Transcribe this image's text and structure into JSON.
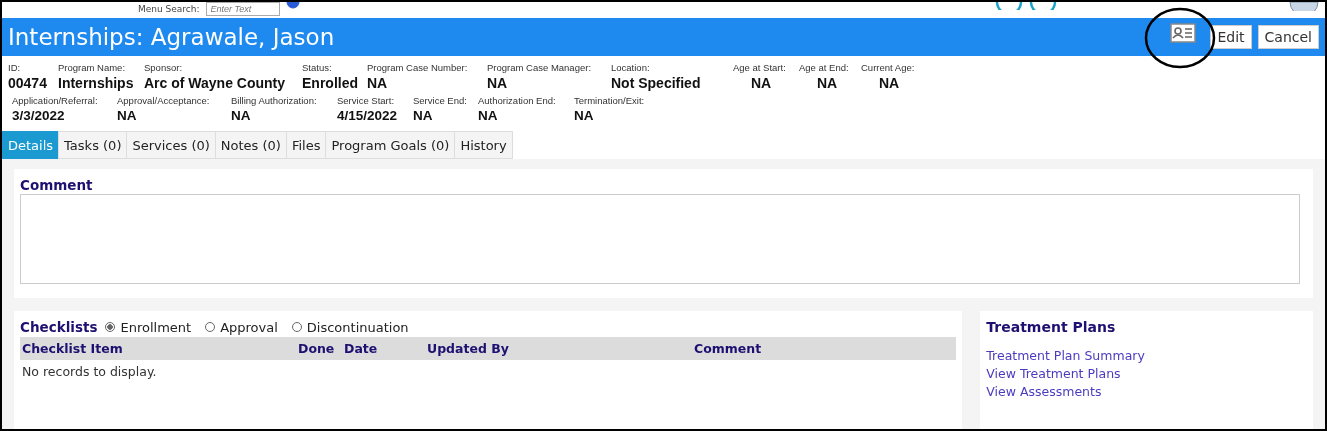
{
  "top_bar": {
    "search_label": "Menu Search:",
    "search_placeholder": "Enter Text"
  },
  "header": {
    "title": "Internships: Agrawale, Jason",
    "buttons": [
      {
        "label": "Edit"
      },
      {
        "label": "Cancel"
      }
    ]
  },
  "fields_row_1": [
    {
      "label": "ID:",
      "value": "00474"
    },
    {
      "label": "Program Name:",
      "value": "Internships"
    },
    {
      "label": "Sponsor:",
      "value": "Arc of Wayne County"
    },
    {
      "label": "Status:",
      "value": "Enrolled"
    },
    {
      "label": "Program Case Number:",
      "value": "NA"
    },
    {
      "label": "Program Case Manager:",
      "value": "NA"
    },
    {
      "label": "Location:",
      "value": "Not Specified"
    },
    {
      "label": "Age at Start:",
      "value": "NA"
    },
    {
      "label": "Age at End:",
      "value": "NA"
    },
    {
      "label": "Current Age:",
      "value": "NA"
    }
  ],
  "fields_row_2": [
    {
      "label": "Application/Referral:",
      "value": "3/3/2022"
    },
    {
      "label": "Approval/Acceptance:",
      "value": "NA"
    },
    {
      "label": "Billing Authorization:",
      "value": "NA"
    },
    {
      "label": "Service Start:",
      "value": "4/15/2022"
    },
    {
      "label": "Service End:",
      "value": "NA"
    },
    {
      "label": "Authorization End:",
      "value": "NA"
    },
    {
      "label": "Termination/Exit:",
      "value": "NA"
    }
  ],
  "tabs": [
    {
      "label": "Details",
      "selected": true
    },
    {
      "label": "Tasks (0)",
      "selected": false
    },
    {
      "label": "Services (0)",
      "selected": false
    },
    {
      "label": "Notes (0)",
      "selected": false
    },
    {
      "label": "Files",
      "selected": false
    },
    {
      "label": "Program Goals (0)",
      "selected": false
    },
    {
      "label": "History",
      "selected": false
    }
  ],
  "comment": {
    "title": "Comment"
  },
  "checklists": {
    "title": "Checklists",
    "options": [
      {
        "label": "Enrollment",
        "selected": true
      },
      {
        "label": "Approval",
        "selected": false
      },
      {
        "label": "Discontinuation",
        "selected": false
      }
    ],
    "table": {
      "columns": [
        "Checklist Item",
        "Done",
        "Date",
        "Updated By",
        "Comment"
      ],
      "empty_message": "No records to display."
    }
  },
  "treatment_plans": {
    "title": "Treatment Plans",
    "links": [
      "Treatment Plan Summary",
      "View Treatment Plans",
      "View Assessments"
    ]
  }
}
